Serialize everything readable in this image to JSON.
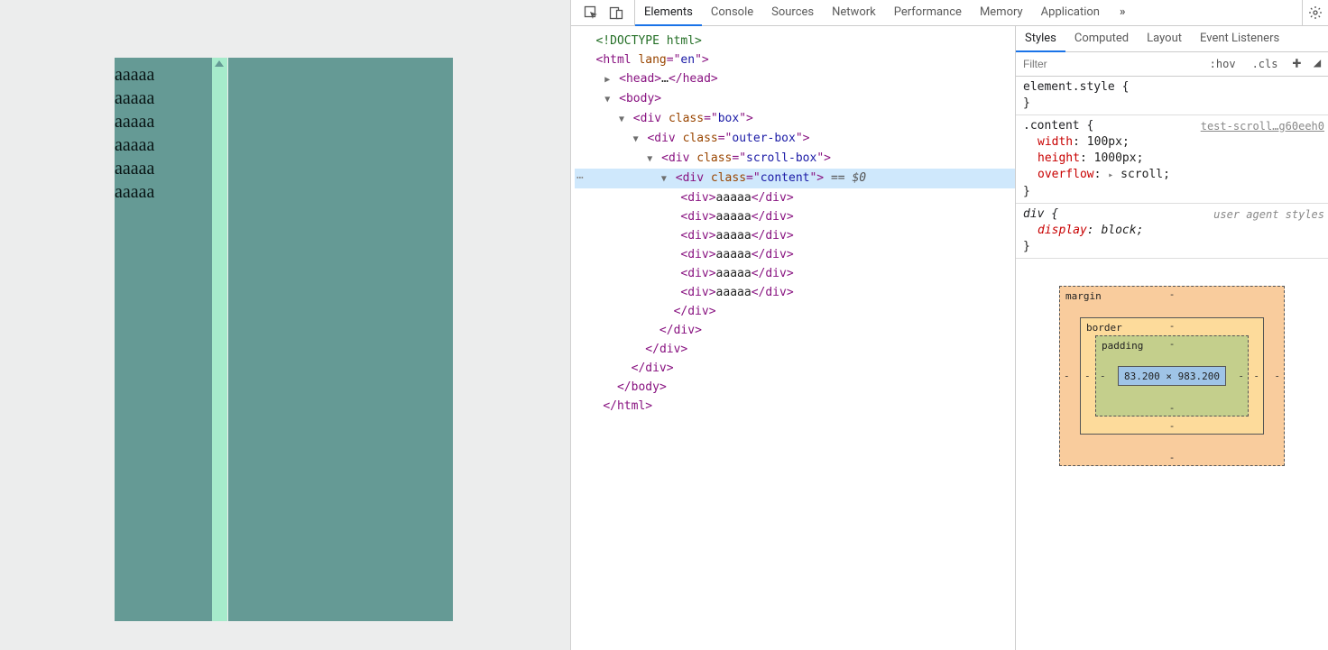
{
  "preview": {
    "rows": [
      "aaaaa",
      "aaaaa",
      "aaaaa",
      "aaaaa",
      "aaaaa",
      "aaaaa"
    ]
  },
  "top_tabs": {
    "elements": "Elements",
    "console": "Console",
    "sources": "Sources",
    "network": "Network",
    "performance": "Performance",
    "memory": "Memory",
    "application": "Application",
    "overflow": "»"
  },
  "dom": {
    "doctype": "<!DOCTYPE html>",
    "html_open": "html",
    "lang_attr": "lang",
    "lang_val": "en",
    "head": "head",
    "ellipsis": "…",
    "body": "body",
    "div": "div",
    "class_attr": "class",
    "box_val": "box",
    "outer_val": "outer-box",
    "scroll_val": "scroll-box",
    "content_val": "content",
    "eq_zero": " == $0",
    "child_text": "aaaaa"
  },
  "side_tabs": {
    "styles": "Styles",
    "computed": "Computed",
    "layout": "Layout",
    "event": "Event Listeners"
  },
  "filter": {
    "placeholder": "Filter",
    "hov": ":hov",
    "cls": ".cls"
  },
  "rules": {
    "element_style": "element.style {",
    "close": "}",
    "content_sel": ".content {",
    "content_src": "test-scroll…g60eeh0",
    "width_name": "width",
    "width_val": "100px",
    "height_name": "height",
    "height_val": "1000px",
    "overflow_name": "overflow",
    "overflow_val": "scroll",
    "div_sel": "div {",
    "ua_src": "user agent styles",
    "display_name": "display",
    "display_val": "block"
  },
  "boxmodel": {
    "margin_label": "margin",
    "border_label": "border",
    "padding_label": "padding",
    "dash": "-",
    "content": "83.200 × 983.200"
  }
}
